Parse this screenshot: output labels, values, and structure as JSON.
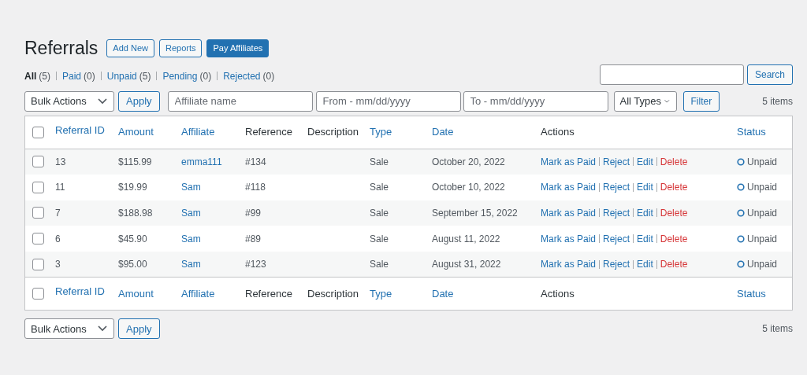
{
  "title": "Referrals",
  "header_buttons": [
    {
      "label": "Add New",
      "kind": "secondary"
    },
    {
      "label": "Reports",
      "kind": "secondary"
    },
    {
      "label": "Pay Affiliates",
      "kind": "primary"
    }
  ],
  "views": [
    {
      "label": "All",
      "count": "(5)",
      "selected": true
    },
    {
      "label": "Paid",
      "count": "(0)",
      "selected": false
    },
    {
      "label": "Unpaid",
      "count": "(5)",
      "selected": false
    },
    {
      "label": "Pending",
      "count": "(0)",
      "selected": false
    },
    {
      "label": "Rejected",
      "count": "(0)",
      "selected": false
    }
  ],
  "search": {
    "button": "Search"
  },
  "filters": {
    "bulk_actions": "Bulk Actions",
    "apply": "Apply",
    "affiliate_placeholder": "Affiliate name",
    "from_placeholder": "From - mm/dd/yyyy",
    "to_placeholder": "To - mm/dd/yyyy",
    "type": "All Types",
    "filter": "Filter",
    "count": "5 items"
  },
  "table": {
    "columns": [
      {
        "label": "Referral ID",
        "sortable": true
      },
      {
        "label": "Amount",
        "sortable": true
      },
      {
        "label": "Affiliate",
        "sortable": true
      },
      {
        "label": "Reference",
        "sortable": false
      },
      {
        "label": "Description",
        "sortable": false
      },
      {
        "label": "Type",
        "sortable": true
      },
      {
        "label": "Date",
        "sortable": true
      },
      {
        "label": "Actions",
        "sortable": false
      },
      {
        "label": "Status",
        "sortable": true
      }
    ],
    "rows": [
      {
        "checked": false,
        "id": "13",
        "amount": "$115.99",
        "affiliate": "emma111",
        "reference": "#134",
        "type": "Sale",
        "date": "October 20, 2022",
        "actions": [
          {
            "label": "Mark as Paid",
            "kind": "link"
          },
          {
            "label": "Reject",
            "kind": "link"
          },
          {
            "label": "Edit",
            "kind": "link"
          },
          {
            "label": "Delete",
            "kind": "danger"
          }
        ],
        "status": "Unpaid"
      },
      {
        "checked": false,
        "id": "11",
        "amount": "$19.99",
        "affiliate": "Sam",
        "reference": "#118",
        "type": "Sale",
        "date": "October 10, 2022",
        "actions": [
          {
            "label": "Mark as Paid",
            "kind": "link"
          },
          {
            "label": "Reject",
            "kind": "link"
          },
          {
            "label": "Edit",
            "kind": "link"
          },
          {
            "label": "Delete",
            "kind": "danger"
          }
        ],
        "status": "Unpaid"
      },
      {
        "checked": false,
        "id": "7",
        "amount": "$188.98",
        "affiliate": "Sam",
        "reference": "#99",
        "type": "Sale",
        "date": "September 15, 2022",
        "actions": [
          {
            "label": "Mark as Paid",
            "kind": "link"
          },
          {
            "label": "Reject",
            "kind": "link"
          },
          {
            "label": "Edit",
            "kind": "link"
          },
          {
            "label": "Delete",
            "kind": "danger"
          }
        ],
        "status": "Unpaid"
      },
      {
        "checked": false,
        "id": "6",
        "amount": "$45.90",
        "affiliate": "Sam",
        "reference": "#89",
        "type": "Sale",
        "date": "August 11, 2022",
        "actions": [
          {
            "label": "Mark as Paid",
            "kind": "link"
          },
          {
            "label": "Reject",
            "kind": "link"
          },
          {
            "label": "Edit",
            "kind": "link"
          },
          {
            "label": "Delete",
            "kind": "danger"
          }
        ],
        "status": "Unpaid"
      },
      {
        "checked": false,
        "id": "3",
        "amount": "$95.00",
        "affiliate": "Sam",
        "reference": "#123",
        "type": "Sale",
        "date": "August 31, 2022",
        "actions": [
          {
            "label": "Mark as Paid",
            "kind": "link"
          },
          {
            "label": "Reject",
            "kind": "link"
          },
          {
            "label": "Edit",
            "kind": "link"
          },
          {
            "label": "Delete",
            "kind": "danger"
          }
        ],
        "status": "Unpaid"
      }
    ],
    "footer_columns": [
      {
        "label": "Referral ID",
        "sortable": true
      },
      {
        "label": "Amount",
        "sortable": true
      },
      {
        "label": "Affiliate",
        "sortable": true
      },
      {
        "label": "Reference",
        "sortable": false
      },
      {
        "label": "Description",
        "sortable": false
      },
      {
        "label": "Type",
        "sortable": true
      },
      {
        "label": "Date",
        "sortable": true
      },
      {
        "label": "Actions",
        "sortable": false
      },
      {
        "label": "Status",
        "sortable": true
      }
    ],
    "header_checked": false,
    "footer_checked": false
  },
  "bottom": {
    "bulk_actions": "Bulk Actions",
    "apply": "Apply",
    "count": "5 items"
  }
}
